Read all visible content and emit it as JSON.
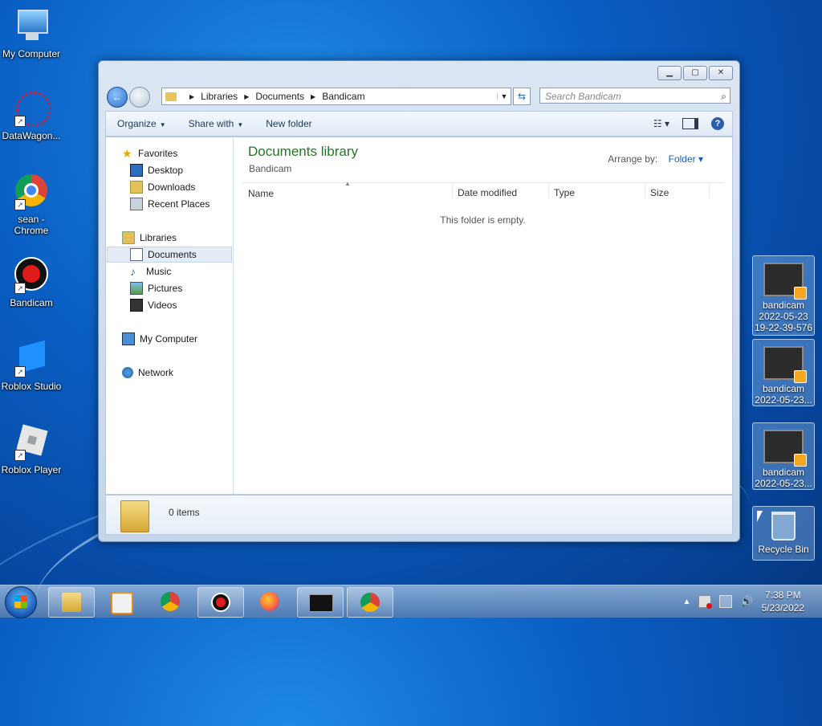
{
  "desktop": {
    "icons": [
      {
        "label": "My Computer"
      },
      {
        "label": "DataWagon..."
      },
      {
        "label": "sean - Chrome"
      },
      {
        "label": "Bandicam"
      },
      {
        "label": "Roblox Studio"
      },
      {
        "label": "Roblox Player"
      }
    ],
    "right_icons": [
      {
        "line1": "bandicam",
        "line2": "2022-05-23",
        "line3": "19-22-39-576"
      },
      {
        "line1": "bandicam",
        "line2": "2022-05-23..."
      },
      {
        "line1": "bandicam",
        "line2": "2022-05-23..."
      }
    ],
    "recycle_bin": "Recycle Bin"
  },
  "window": {
    "address": {
      "crumbs": [
        "Libraries",
        "Documents",
        "Bandicam"
      ]
    },
    "search_placeholder": "Search Bandicam",
    "toolbar": {
      "organize": "Organize",
      "share_with": "Share with",
      "new_folder": "New folder"
    },
    "nav": {
      "favorites": "Favorites",
      "desktop": "Desktop",
      "downloads": "Downloads",
      "recent_places": "Recent Places",
      "libraries": "Libraries",
      "documents": "Documents",
      "music": "Music",
      "pictures": "Pictures",
      "videos": "Videos",
      "my_computer": "My Computer",
      "network": "Network"
    },
    "main": {
      "title": "Documents library",
      "subtitle": "Bandicam",
      "arrange_label": "Arrange by:",
      "arrange_value": "Folder",
      "columns": {
        "name": "Name",
        "date_modified": "Date modified",
        "type": "Type",
        "size": "Size"
      },
      "empty_message": "This folder is empty."
    },
    "details": {
      "items": "0 items"
    }
  },
  "taskbar": {
    "time": "7:38 PM",
    "date": "5/23/2022"
  }
}
